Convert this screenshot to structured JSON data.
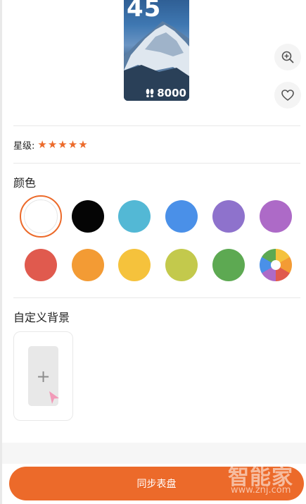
{
  "preview": {
    "time": "45",
    "steps": "8000"
  },
  "actions": {
    "zoom_icon": "zoom-in-icon",
    "favorite_icon": "heart-icon"
  },
  "rating": {
    "label": "星级:",
    "stars": 5
  },
  "colors": {
    "title": "颜色",
    "swatches": [
      {
        "color": "#ffffff",
        "selected": true
      },
      {
        "color": "#050505"
      },
      {
        "color": "#53b8d5"
      },
      {
        "color": "#4a90e8"
      },
      {
        "color": "#8e72cc"
      },
      {
        "color": "#ad6ac7"
      },
      {
        "color": "#e05a4e"
      },
      {
        "color": "#f39b34"
      },
      {
        "color": "#f5c23c"
      },
      {
        "color": "#c3c94c"
      },
      {
        "color": "#5da952"
      },
      {
        "color": "multicolor"
      }
    ]
  },
  "custom_bg": {
    "title": "自定义背景",
    "add_symbol": "+"
  },
  "footer": {
    "sync_label": "同步表盘",
    "watermark_main": "智能家",
    "watermark_url": "www.znj.com",
    "accent": "#ec6a2a"
  }
}
